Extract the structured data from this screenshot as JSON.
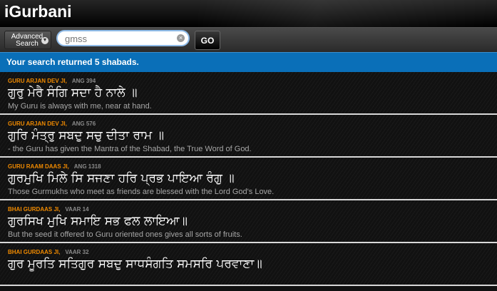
{
  "app": {
    "title": "iGurbani"
  },
  "search": {
    "advanced_label_line1": "Advanced",
    "advanced_label_line2": "Search",
    "value": "gmss",
    "go_label": "GO"
  },
  "banner": {
    "text": "Your search returned 5 shabads."
  },
  "results": [
    {
      "author": "GURU ARJAN DEV JI,",
      "source": "ANG 394",
      "gurmukhi": "ਗੁਰੁ ਮੇਰੈ ਸੰਗਿ ਸਦਾ ਹੈ ਨਾਲੇ ॥",
      "translation": "My Guru is always with me, near at hand."
    },
    {
      "author": "GURU ARJAN DEV JI,",
      "source": "ANG 576",
      "gurmukhi": "ਗੁਰਿ ਮੰਤ੍ਰੁ ਸਬਦੁ ਸਚੁ ਦੀਤਾ ਰਾਮ ॥",
      "translation": "- the Guru has given the Mantra of the Shabad, the True Word of God."
    },
    {
      "author": "GURU RAAM DAAS JI,",
      "source": "ANG 1318",
      "gurmukhi": "ਗੁਰਮੁਖਿ ਮਿਲੇ ਸਿ ਸਜਣਾ ਹਰਿ ਪ੍ਰਭ ਪਾਇਆ ਰੰਗੁ ॥",
      "translation": "Those Gurmukhs who meet as friends are blessed with the Lord God's Love."
    },
    {
      "author": "BHAI GURDAAS JI,",
      "source": "VAAR 14",
      "gurmukhi": "ਗੁਰਸਿਖ ਮੁਖਿ ਸਮਾਇ ਸਭ ਫਲ ਲਾਇਆ॥",
      "translation": "But the seed it offered to Guru oriented ones gives all sorts of fruits."
    },
    {
      "author": "BHAI GURDAAS JI,",
      "source": "VAAR 32",
      "gurmukhi": "ਗੁਰ ਮੂਰਤਿ ਸਤਿਗੁਰ ਸਬਦੁ ਸਾਧਸੰਗਤਿ ਸਮਸਰਿ ਪਰਵਾਣਾ॥",
      "translation": ""
    }
  ],
  "colors": {
    "banner_bg": "#0a6fb8",
    "author": "#f08a00",
    "source": "#8a8a8a",
    "gurmukhi": "#ffffff",
    "translation": "#a7a7a7",
    "divider": "#d8d8d8"
  }
}
